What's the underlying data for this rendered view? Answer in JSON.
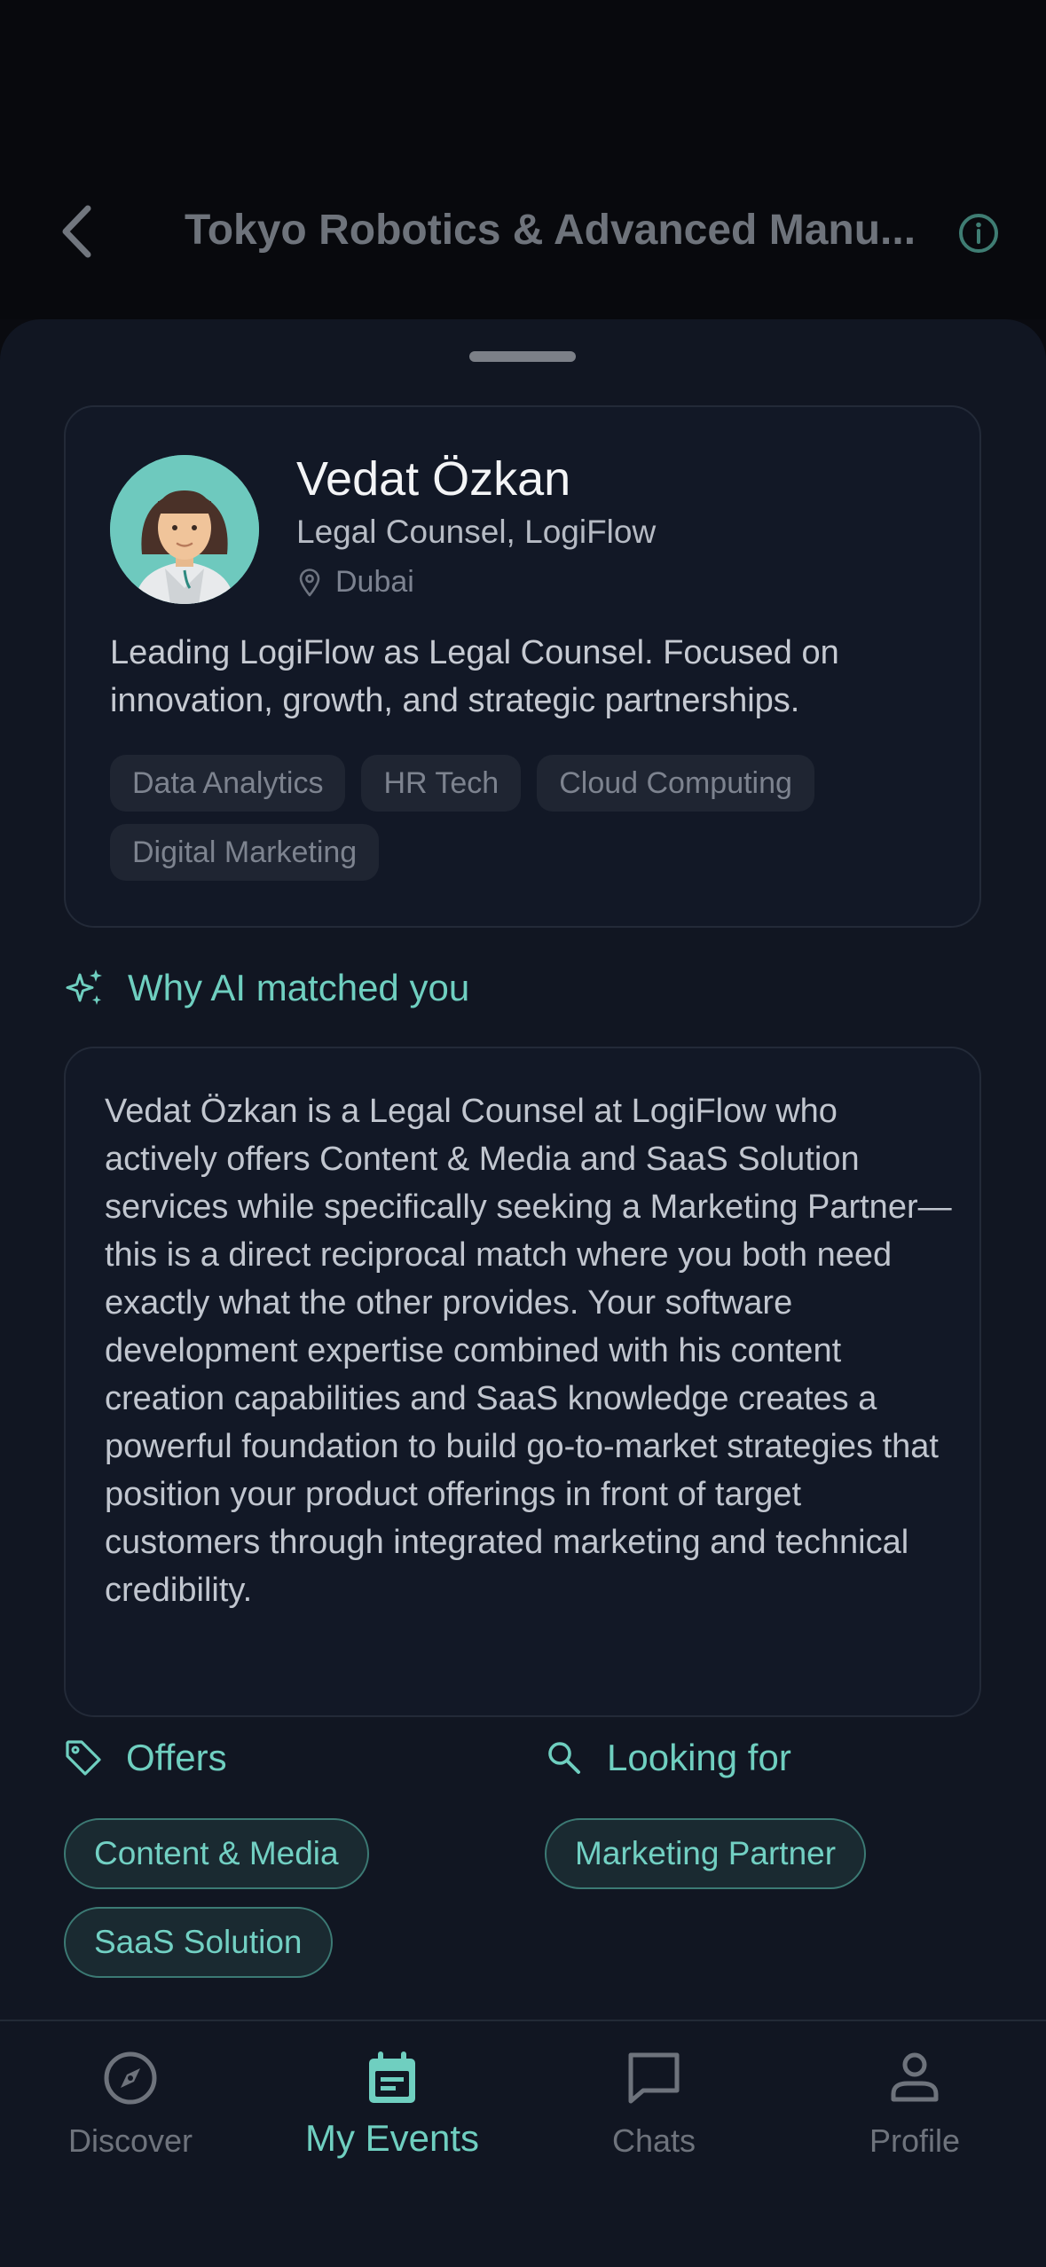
{
  "header": {
    "title": "Tokyo Robotics & Advanced Manu...",
    "back_icon": "chevron-left-icon",
    "info_icon": "info-icon"
  },
  "profile": {
    "name": "Vedat Özkan",
    "role": "Legal Counsel, LogiFlow",
    "location": "Dubai",
    "bio": "Leading LogiFlow as Legal Counsel. Focused on innovation, growth, and strategic partnerships.",
    "tags": [
      "Data Analytics",
      "HR Tech",
      "Cloud Computing",
      "Digital Marketing"
    ]
  },
  "match": {
    "heading": "Why AI matched you",
    "reason": "Vedat Özkan is a Legal Counsel at LogiFlow who actively offers Content & Media and SaaS Solution services while specifically seeking a Marketing Partner—this is a direct reciprocal match where you both need exactly what the other provides. Your software development expertise combined with his content creation capabilities and SaaS knowledge creates a powerful foundation to build go-to-market strategies that position your product offerings in front of target customers through integrated marketing and technical credibility."
  },
  "offers": {
    "heading": "Offers",
    "items": [
      "Content & Media",
      "SaaS Solution"
    ]
  },
  "looking_for": {
    "heading": "Looking for",
    "items": [
      "Marketing Partner"
    ]
  },
  "tabbar": {
    "tabs": [
      {
        "label": "Discover",
        "icon": "compass-icon"
      },
      {
        "label": "My Events",
        "icon": "calendar-icon",
        "active": true
      },
      {
        "label": "Chats",
        "icon": "chat-bubble-icon"
      },
      {
        "label": "Profile",
        "icon": "person-icon"
      }
    ]
  },
  "colors": {
    "accent": "#6fcfc0",
    "background": "#111622",
    "card": "#121826"
  }
}
